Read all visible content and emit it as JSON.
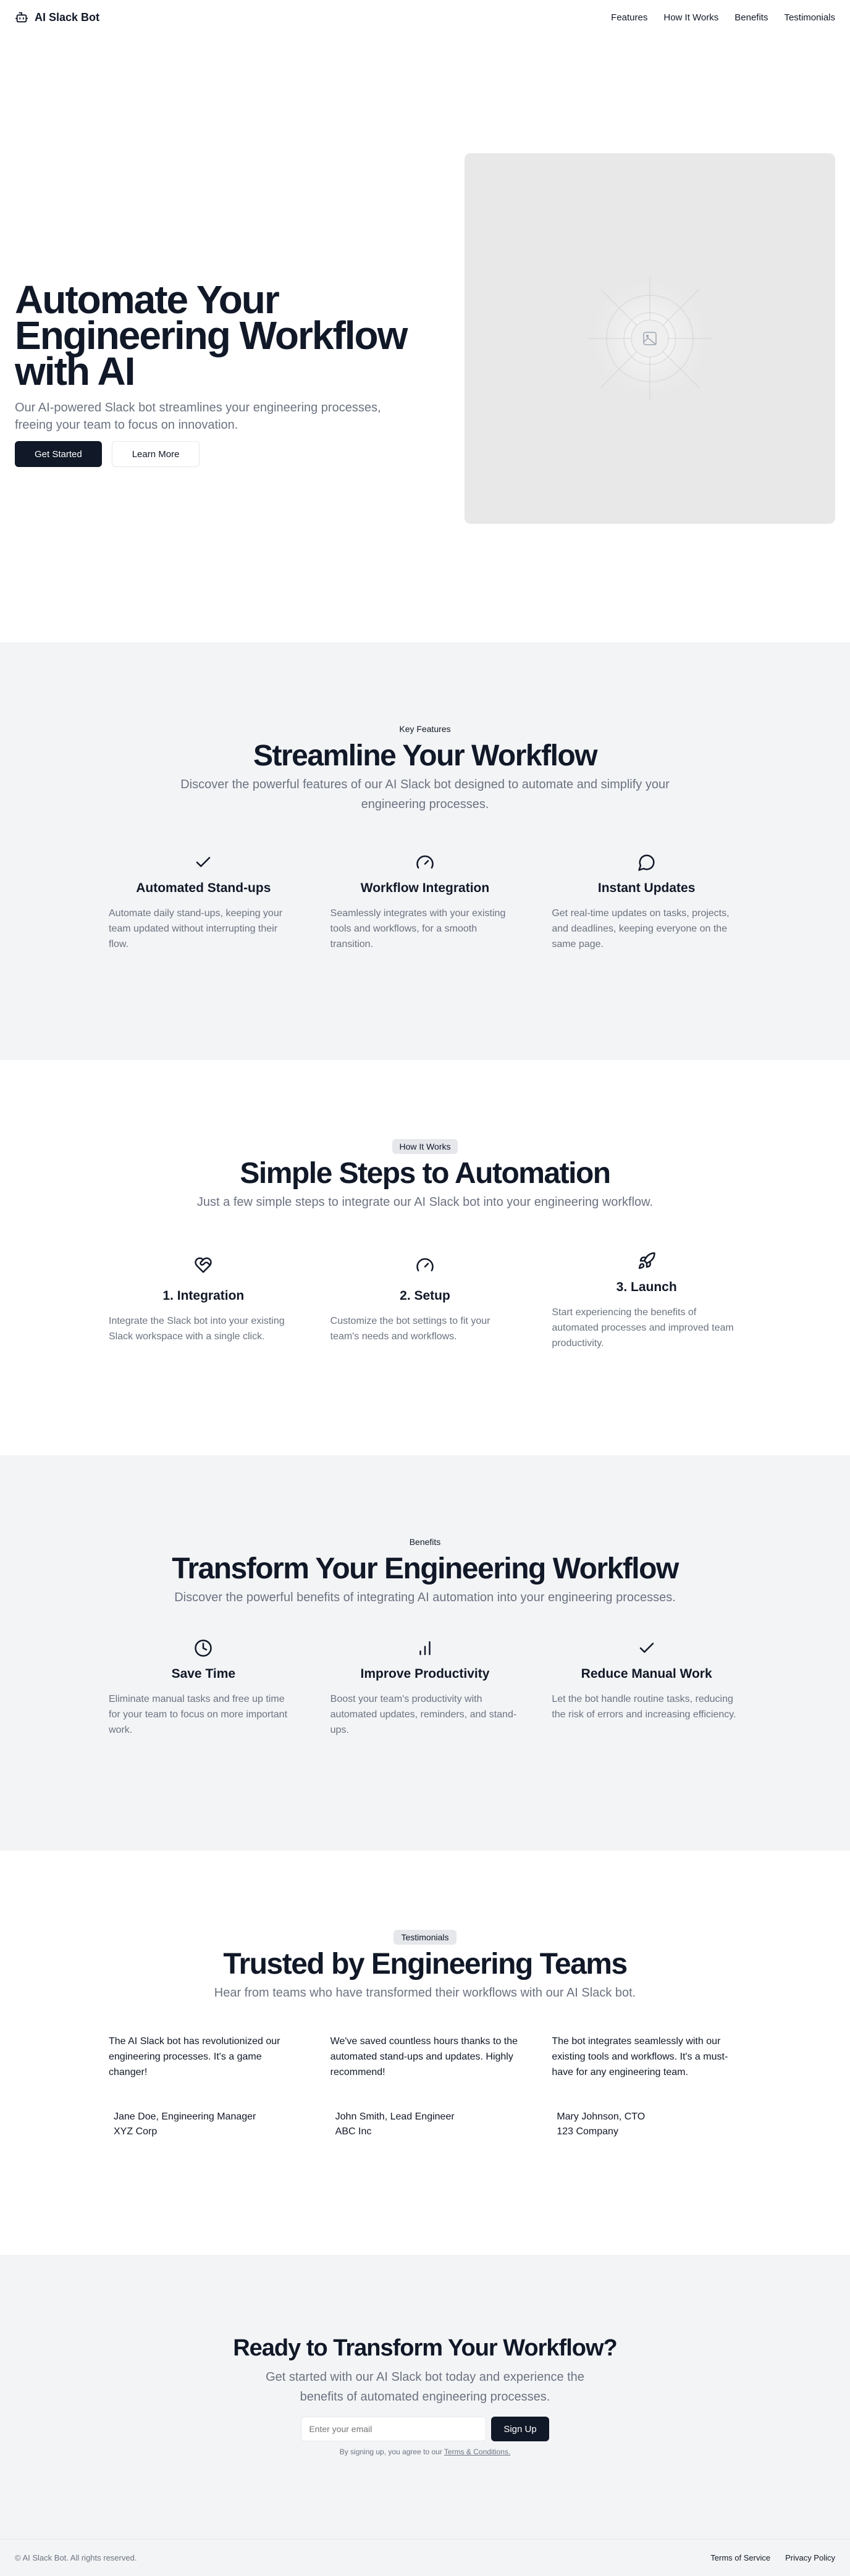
{
  "header": {
    "brand": "AI Slack Bot",
    "nav": [
      "Features",
      "How It Works",
      "Benefits",
      "Testimonials"
    ]
  },
  "hero": {
    "title_lines": [
      "Automate Your",
      "Engineering Workflow",
      "with AI"
    ],
    "subtitle": "Our AI-powered Slack bot streamlines your engineering processes, freeing your team to focus on innovation.",
    "primary_button": "Get Started",
    "secondary_button": "Learn More",
    "image_icon": "image-placeholder-icon"
  },
  "features": {
    "badge": "Key Features",
    "title": "Streamline Your Workflow",
    "subtitle": "Discover the powerful features of our AI Slack bot designed to automate and simplify your engineering processes.",
    "items": [
      {
        "icon": "check-icon",
        "title": "Automated Stand-ups",
        "text": "Automate daily stand-ups, keeping your team updated without interrupting their flow."
      },
      {
        "icon": "gauge-icon",
        "title": "Workflow Integration",
        "text": "Seamlessly integrates with your existing tools and workflows, for a smooth transition."
      },
      {
        "icon": "message-circle-icon",
        "title": "Instant Updates",
        "text": "Get real-time updates on tasks, projects, and deadlines, keeping everyone on the same page."
      }
    ]
  },
  "how": {
    "badge": "How It Works",
    "title": "Simple Steps to Automation",
    "subtitle": "Just a few simple steps to integrate our AI Slack bot into your engineering workflow.",
    "items": [
      {
        "icon": "heart-handshake-icon",
        "title": "1. Integration",
        "text": "Integrate the Slack bot into your existing Slack workspace with a single click."
      },
      {
        "icon": "gauge-icon",
        "title": "2. Setup",
        "text": "Customize the bot settings to fit your team's needs and workflows."
      },
      {
        "icon": "rocket-icon",
        "title": "3. Launch",
        "text": "Start experiencing the benefits of automated processes and improved team productivity."
      }
    ]
  },
  "benefits": {
    "badge": "Benefits",
    "title": "Transform Your Engineering Workflow",
    "subtitle": "Discover the powerful benefits of integrating AI automation into your engineering processes.",
    "items": [
      {
        "icon": "clock-icon",
        "title": "Save Time",
        "text": "Eliminate manual tasks and free up time for your team to focus on more important work."
      },
      {
        "icon": "bar-chart-icon",
        "title": "Improve Productivity",
        "text": "Boost your team's productivity with automated updates, reminders, and stand-ups."
      },
      {
        "icon": "check-icon",
        "title": "Reduce Manual Work",
        "text": "Let the bot handle routine tasks, reducing the risk of errors and increasing efficiency."
      }
    ]
  },
  "testimonials": {
    "badge": "Testimonials",
    "title": "Trusted by Engineering Teams",
    "subtitle": "Hear from teams who have transformed their workflows with our AI Slack bot.",
    "items": [
      {
        "quote": "The AI Slack bot has revolutionized our engineering processes. It's a game changer!",
        "name": "Jane Doe, Engineering Manager",
        "company": "XYZ Corp"
      },
      {
        "quote": "We've saved countless hours thanks to the automated stand-ups and updates. Highly recommend!",
        "name": "John Smith, Lead Engineer",
        "company": "ABC Inc"
      },
      {
        "quote": "The bot integrates seamlessly with our existing tools and workflows. It's a must-have for any engineering team.",
        "name": "Mary Johnson, CTO",
        "company": "123 Company"
      }
    ]
  },
  "cta": {
    "title": "Ready to Transform Your Workflow?",
    "subtitle": "Get started with our AI Slack bot today and experience the benefits of automated engineering processes.",
    "email_placeholder": "Enter your email",
    "button": "Sign Up",
    "fine_prefix": "By signing up, you agree to our",
    "fine_link": "Terms & Conditions."
  },
  "footer": {
    "copyright": "© AI Slack Bot. All rights reserved.",
    "links": [
      "Terms of Service",
      "Privacy Policy"
    ]
  }
}
